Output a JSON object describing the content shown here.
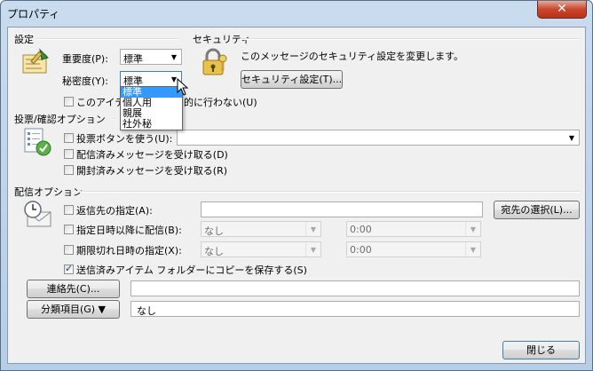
{
  "window": {
    "title": "プロパティ",
    "close_glyph": "✕"
  },
  "settings": {
    "group_label": "設定",
    "importance_label": "重要度(P):",
    "importance_value": "標準",
    "sensitivity_label": "秘密度(Y):",
    "sensitivity_value": "標準",
    "sensitivity_options": [
      "標準",
      "個人用",
      "親展",
      "社外秘"
    ],
    "autoarchive_label_left": "このアイテ",
    "autoarchive_label_right": "的に行わない(U)"
  },
  "security": {
    "group_label": "セキュリティ",
    "description": "このメッセージのセキュリティ設定を変更します。",
    "button_label": "セキュリティ設定(T)..."
  },
  "voting": {
    "group_label": "投票/確認オプション",
    "use_voting_label": "投票ボタンを使う(U):",
    "delivery_receipt_label": "配信済みメッセージを受け取る(D)",
    "read_receipt_label": "開封済みメッセージを受け取る(R)"
  },
  "delivery": {
    "group_label": "配信オプション",
    "reply_to_label": "返信先の指定(A):",
    "select_names_label": "宛先の選択(L)...",
    "do_not_deliver_label": "指定日時以降に配信(B):",
    "expires_label": "期限切れ日時の指定(X):",
    "date_none": "なし",
    "time_none": "0:00",
    "save_sent_label": "送信済みアイテム フォルダーにコピーを保存する(S)"
  },
  "contacts_button": "連絡先(C)...",
  "categories_button": "分類項目(G) ▼",
  "categories_value": "なし",
  "close_button": "閉じる",
  "colors": {
    "selection": "#3399ff",
    "client_bg": "#f0f0f0"
  }
}
